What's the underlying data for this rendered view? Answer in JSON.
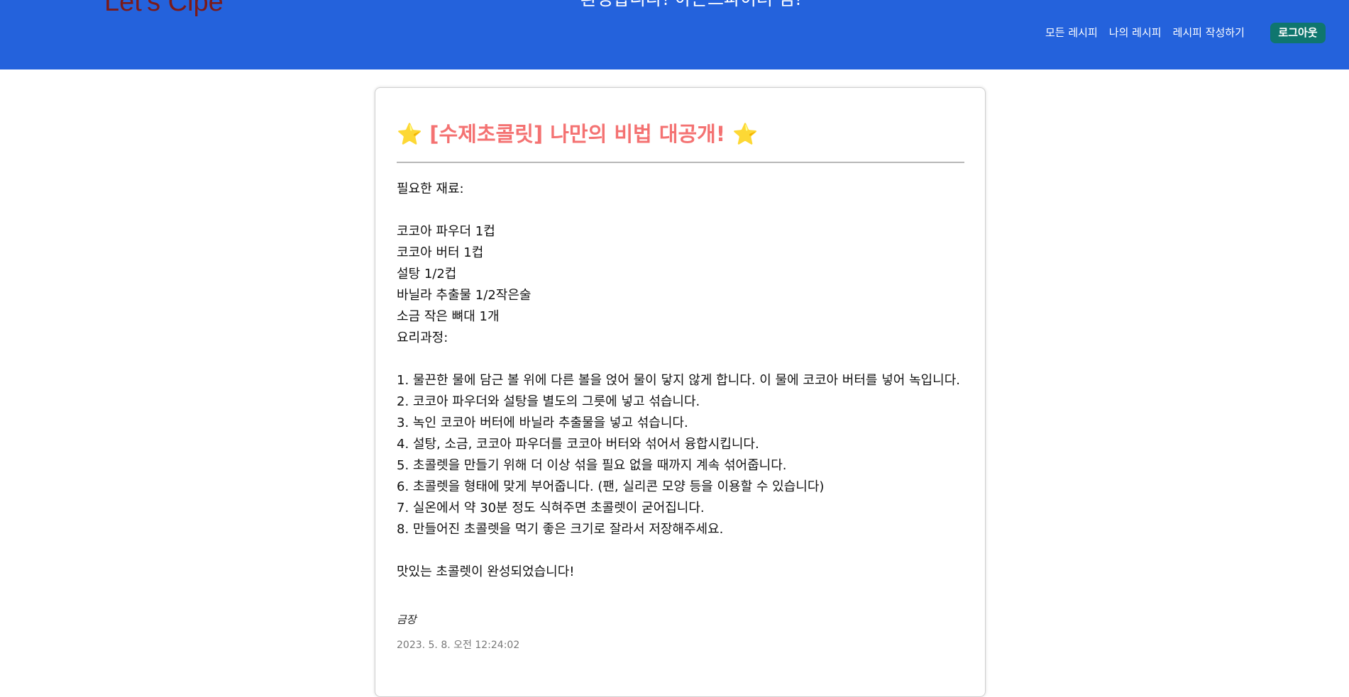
{
  "header": {
    "logo": "Let's Cipe",
    "welcome": "환영합니다! 아몬드파이터 님!",
    "nav": {
      "all_recipes": "모든 레시피",
      "my_recipes": "나의 레시피",
      "write_recipe": "레시피 작성하기"
    },
    "logout_label": "로그아웃"
  },
  "post": {
    "title_star_left": "⭐",
    "title_text": "[수제초콜릿] 나만의 비법 대공개!",
    "title_star_right": "⭐",
    "body": "필요한 재료:\n\n코코아 파우더 1컵\n코코아 버터 1컵\n설탕 1/2컵\n바닐라 추출물 1/2작은술\n소금 작은 뼈대 1개\n요리과정:\n\n1. 물끈한 물에 담근 볼 위에 다른 볼을 얹어 물이 닿지 않게 합니다. 이 물에 코코아 버터를 넣어 녹입니다.\n2. 코코아 파우더와 설탕을 별도의 그릇에 넣고 섞습니다.\n3. 녹인 코코아 버터에 바닐라 추출물을 넣고 섞습니다.\n4. 설탕, 소금, 코코아 파우더를 코코아 버터와 섞어서 융합시킵니다.\n5. 초콜렛을 만들기 위해 더 이상 섞을 필요 없을 때까지 계속 섞어줍니다.\n6. 초콜렛을 형태에 맞게 부어줍니다. (팬, 실리콘 모양 등을 이용할 수 있습니다)\n7. 실온에서 약 30분 정도 식혀주면 초콜렛이 굳어집니다.\n8. 만들어진 초콜렛을 먹기 좋은 크기로 잘라서 저장해주세요.\n\n맛있는 초콜렛이 완성되었습니다!",
    "author": "금장",
    "timestamp": "2023. 5. 8. 오전 12:24:02"
  },
  "colors": {
    "header_bg": "#2462dc",
    "title": "#f47272",
    "logout_bg": "#0f766e",
    "logo": "#7a1a1a"
  }
}
